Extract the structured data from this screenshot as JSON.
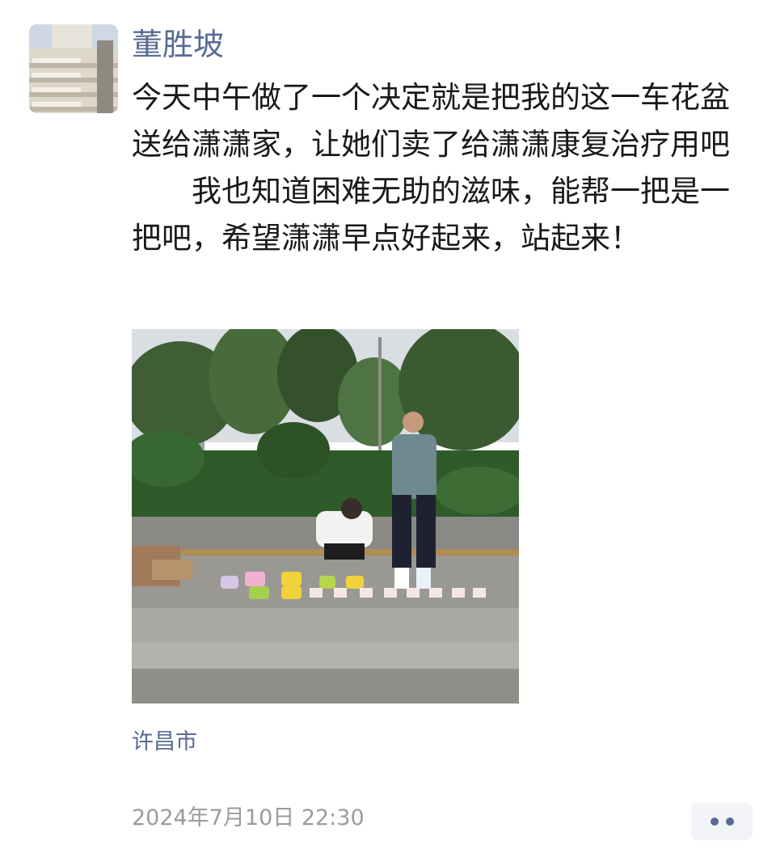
{
  "post": {
    "author_name": "董胜坡",
    "paragraphs": [
      "今天中午做了一个决定就是把我的这一车花盆送给潇潇家，让她们卖了给潇潇康复治疗用吧",
      "　　我也知道困难无助的滋味，能帮一把是一把吧，希望潇潇早点好起来，站起来！"
    ],
    "location": "许昌市",
    "timestamp": "2024年7月10日 22:30"
  },
  "icons": {
    "avatar": "building-photo",
    "more": "more-dots-icon"
  },
  "colors": {
    "name_link": "#576b95",
    "body_text": "#191919",
    "timestamp": "#9b9b9b",
    "more_button_bg": "#f3f4f7"
  }
}
